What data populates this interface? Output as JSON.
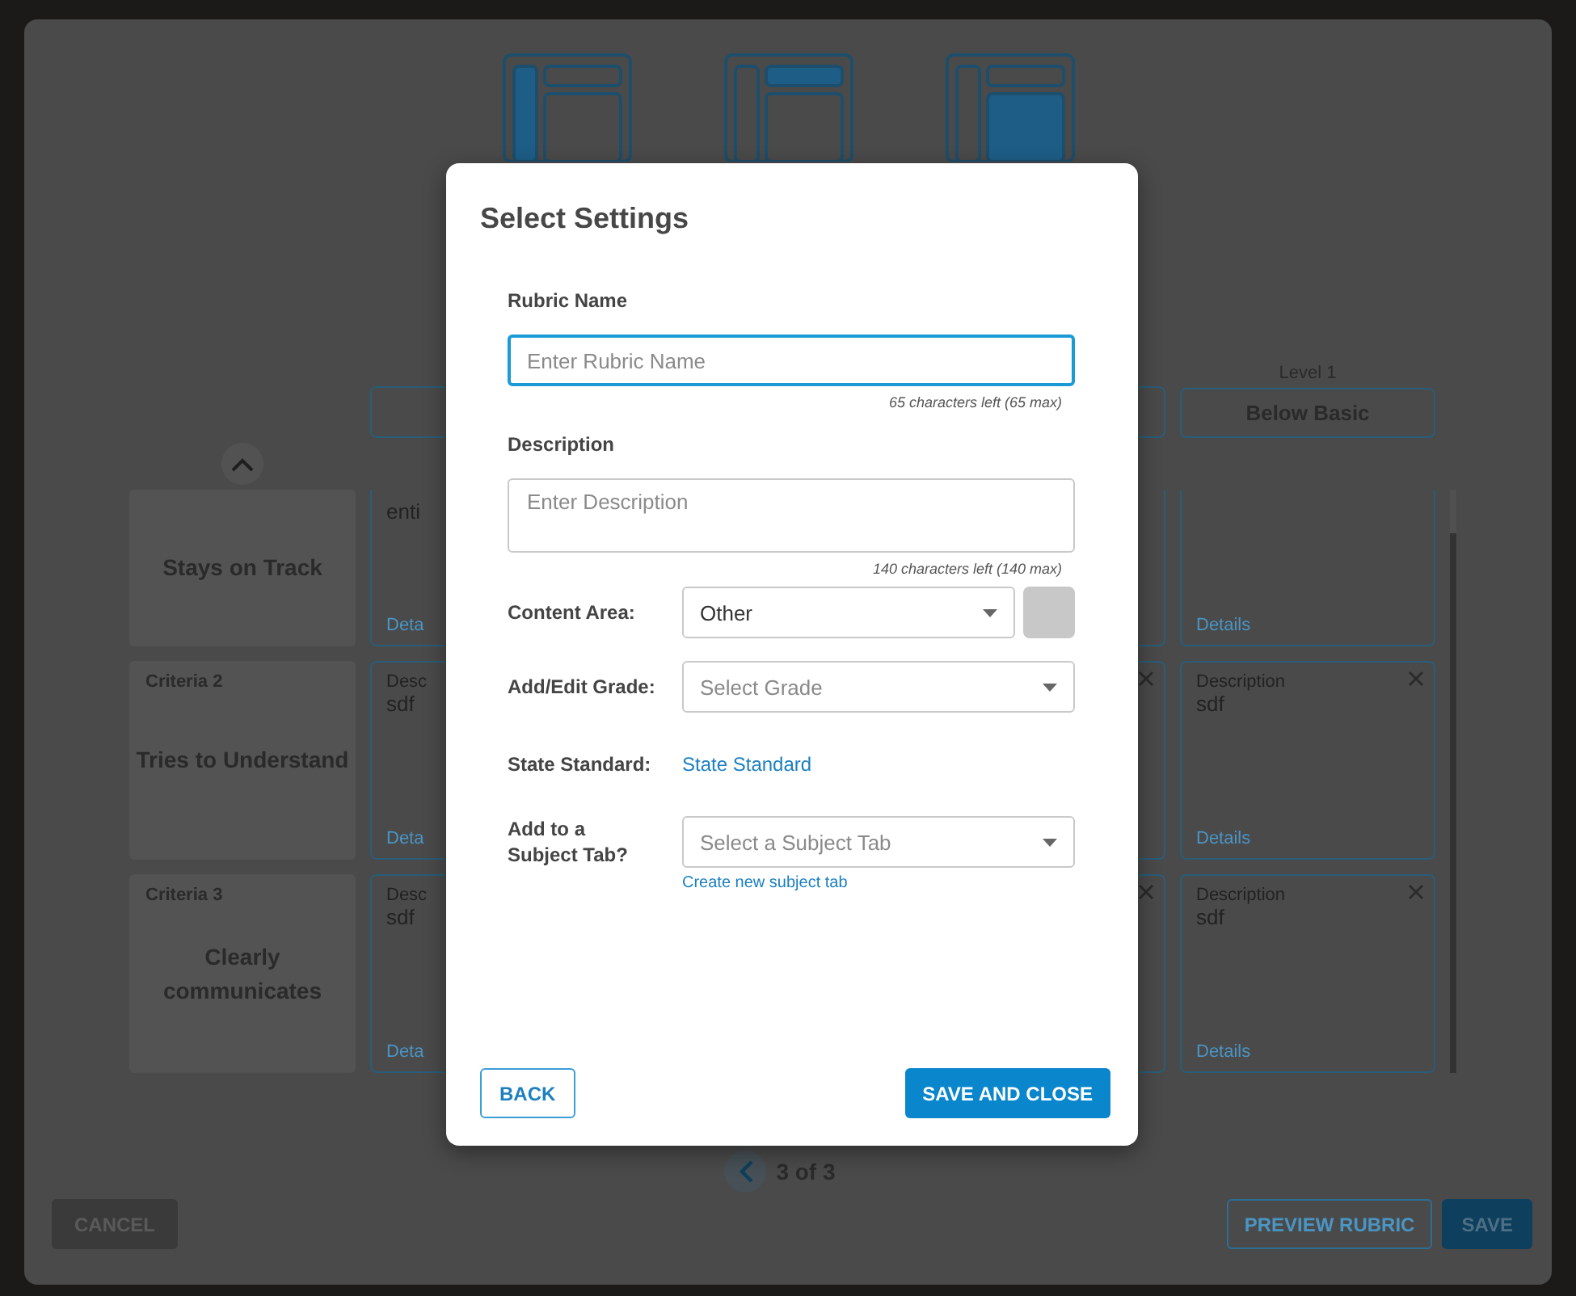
{
  "layout_options": [
    {
      "kind": "sidebar"
    },
    {
      "kind": "header"
    },
    {
      "kind": "main"
    }
  ],
  "level_headers": {
    "column_4": {
      "level": "Level 1",
      "name": "Below Basic"
    }
  },
  "grid_rows": [
    {
      "criterion": {
        "title": "Stays on Track"
      },
      "column_1": {
        "text": "enti",
        "link": "Deta"
      },
      "column_3": {
        "close": false
      },
      "column_4": {
        "link": "Details",
        "close": false
      }
    },
    {
      "criterion": {
        "label": "Criteria 2",
        "title": "Tries to Understand"
      },
      "column_1": {
        "label": "Desc",
        "text": "sdf",
        "link": "Deta"
      },
      "column_3": {
        "close": true
      },
      "column_4": {
        "label": "Description",
        "text": "sdf",
        "link": "Details",
        "close": true
      }
    },
    {
      "criterion": {
        "label": "Criteria 3",
        "title": "Clearly communicates"
      },
      "column_1": {
        "label": "Desc",
        "text": "sdf",
        "link": "Deta"
      },
      "column_3": {
        "close": true
      },
      "column_4": {
        "label": "Description",
        "text": "sdf",
        "link": "Details",
        "close": true
      }
    }
  ],
  "pager": "3 of 3",
  "footer_buttons": {
    "cancel": "CANCEL",
    "preview": "PREVIEW RUBRIC",
    "save": "SAVE"
  },
  "dialog": {
    "title": "Select Settings",
    "rubric_name": {
      "label": "Rubric Name",
      "placeholder": "Enter Rubric Name",
      "focused": true,
      "counter": "65 characters left (65 max)"
    },
    "description": {
      "label": "Description",
      "placeholder": "Enter Description",
      "counter": "140 characters left (140 max)"
    },
    "content_area": {
      "label": "Content Area:",
      "value": "Other"
    },
    "grade": {
      "label": "Add/Edit Grade:",
      "placeholder": "Select Grade"
    },
    "state_standard": {
      "label": "State Standard:",
      "link": "State Standard"
    },
    "subject_tab": {
      "label": "Add to a Subject Tab?",
      "placeholder": "Select a Subject Tab",
      "link": "Create new subject tab"
    },
    "back": "BACK",
    "save_close": "SAVE AND CLOSE"
  }
}
